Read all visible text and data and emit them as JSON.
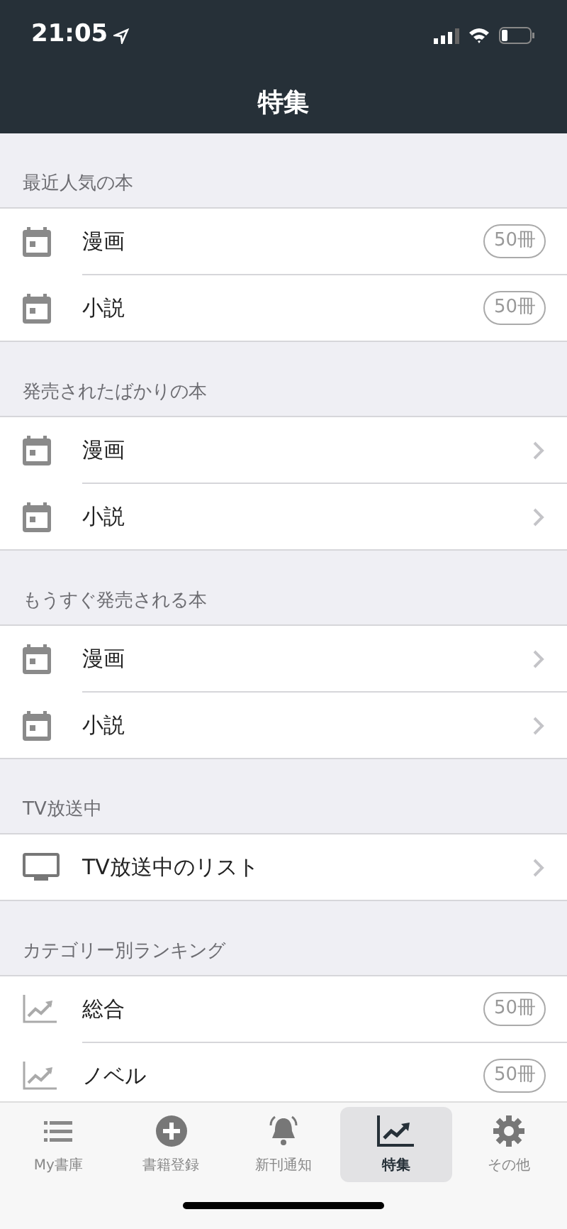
{
  "status_bar": {
    "time": "21:05"
  },
  "nav": {
    "title": "特集"
  },
  "sections": [
    {
      "title": "最近人気の本",
      "rows": [
        {
          "kind": "count",
          "label": "漫画",
          "badge": "50冊"
        },
        {
          "kind": "count",
          "label": "小説",
          "badge": "50冊"
        }
      ]
    },
    {
      "title": "発売されたばかりの本",
      "rows": [
        {
          "kind": "link",
          "label": "漫画"
        },
        {
          "kind": "link",
          "label": "小説"
        }
      ]
    },
    {
      "title": "もうすぐ発売される本",
      "rows": [
        {
          "kind": "link",
          "label": "漫画"
        },
        {
          "kind": "link",
          "label": "小説"
        }
      ]
    },
    {
      "title": "TV放送中",
      "rows": [
        {
          "kind": "link",
          "label": "TV放送中のリスト"
        }
      ]
    },
    {
      "title": "カテゴリー別ランキング",
      "rows": [
        {
          "kind": "count",
          "label": "総合",
          "badge": "50冊"
        },
        {
          "kind": "count",
          "label": "ノベル",
          "badge": "50冊"
        }
      ]
    }
  ],
  "tabs": [
    {
      "label": "My書庫",
      "selected": false
    },
    {
      "label": "書籍登録",
      "selected": false
    },
    {
      "label": "新刊通知",
      "selected": false
    },
    {
      "label": "特集",
      "selected": true
    },
    {
      "label": "その他",
      "selected": false
    }
  ]
}
